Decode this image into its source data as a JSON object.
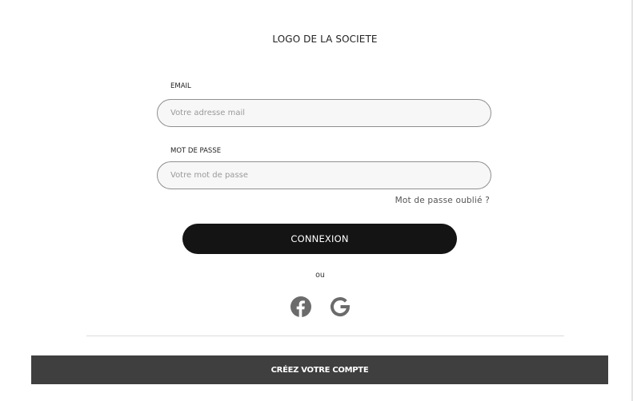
{
  "header": {
    "logo_text": "LOGO DE LA SOCIETE"
  },
  "form": {
    "email": {
      "label": "EMAIL",
      "placeholder": "Votre adresse mail",
      "value": ""
    },
    "password": {
      "label": "MOT DE PASSE",
      "placeholder": "Votre mot de passe",
      "value": ""
    },
    "forgot_link": "Mot de passe oublié ?",
    "submit_label": "CONNEXION"
  },
  "alt_login": {
    "separator_text": "ou",
    "providers": [
      {
        "name": "Facebook",
        "icon": "facebook-icon"
      },
      {
        "name": "Google",
        "icon": "google-icon"
      }
    ]
  },
  "footer": {
    "create_account_label": "CRÉEZ VOTRE COMPTE"
  },
  "colors": {
    "primary_button": "#141414",
    "secondary_button": "#3f3f3f",
    "icon": "#6b6b6b",
    "input_bg": "#f7f7f7"
  }
}
